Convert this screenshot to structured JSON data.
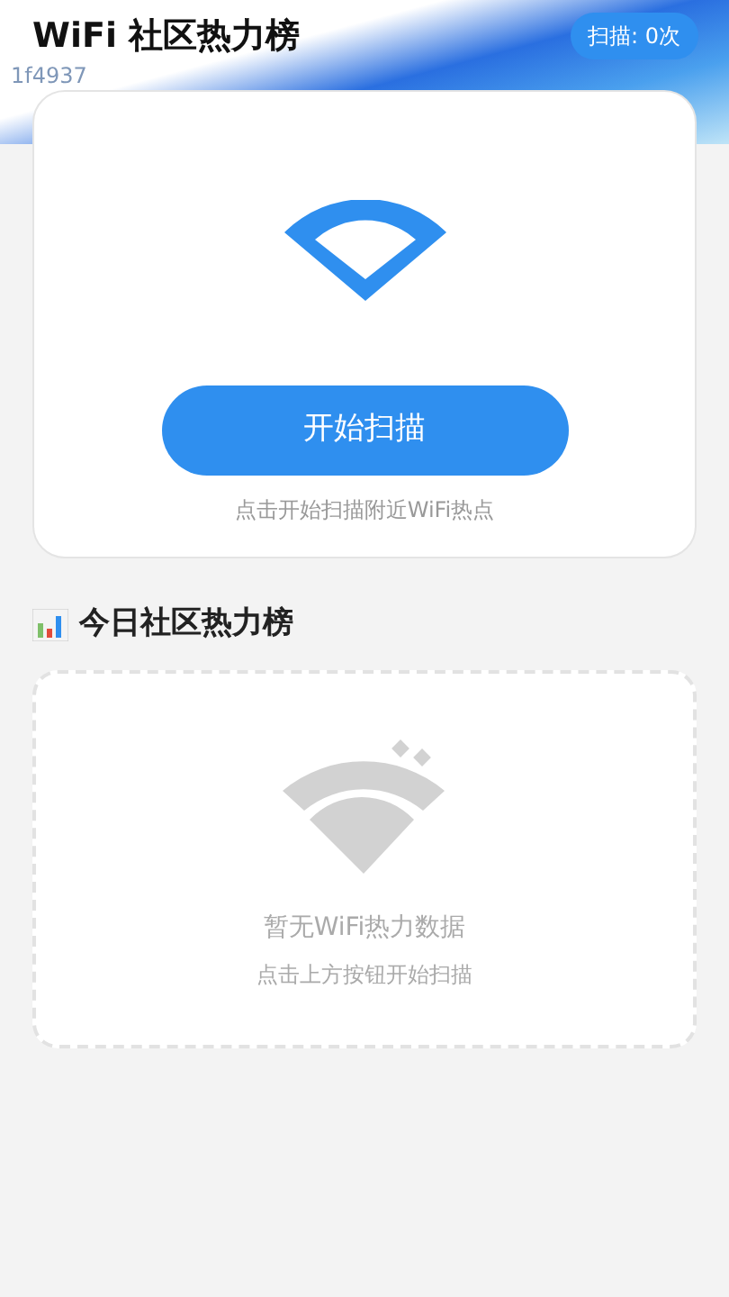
{
  "header": {
    "title": "WiFi 社区热力榜",
    "scan_count": "扫描: 0次",
    "faint_code": "1f4937"
  },
  "scan_card": {
    "button": "开始扫描",
    "hint": "点击开始扫描附近WiFi热点"
  },
  "ranking": {
    "title": "今日社区热力榜",
    "empty_title": "暂无WiFi热力数据",
    "empty_hint": "点击上方按钮开始扫描"
  }
}
